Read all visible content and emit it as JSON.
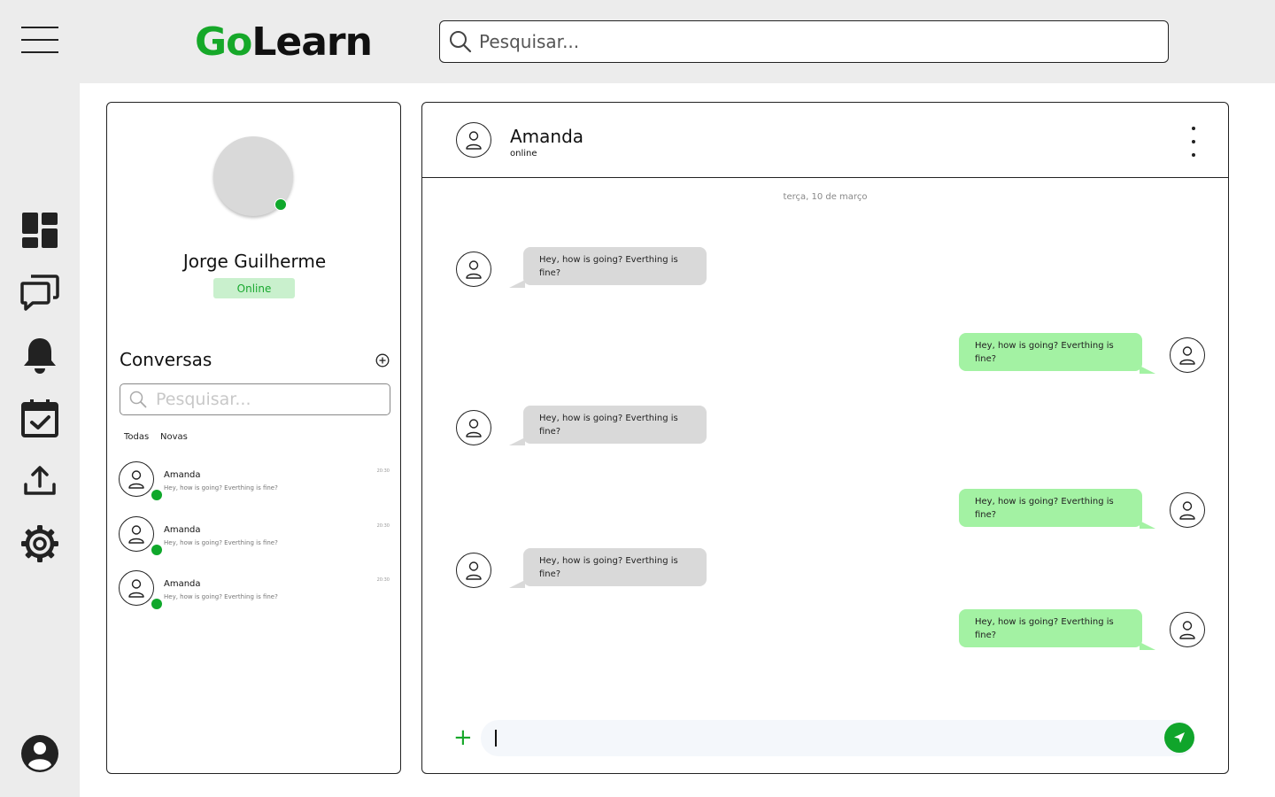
{
  "app": {
    "logo_go": "Go",
    "logo_learn": "Learn"
  },
  "top_search": {
    "placeholder": "Pesquisar..."
  },
  "nav": {
    "icons": [
      "dashboard-icon",
      "chat-bubbles-icon",
      "bell-icon",
      "calendar-check-icon",
      "upload-icon",
      "gear-icon",
      "user-account-icon"
    ]
  },
  "profile": {
    "name": "Jorge Guilherme",
    "status": "Online"
  },
  "conversations": {
    "title": "Conversas",
    "search_placeholder": "Pesquisar...",
    "filters": [
      "Todas",
      "Novas"
    ],
    "items": [
      {
        "name": "Amanda",
        "preview": "Hey, how is going? Everthing is fine?",
        "time": "20:30"
      },
      {
        "name": "Amanda",
        "preview": "Hey, how is going? Everthing is fine?",
        "time": "20:30"
      },
      {
        "name": "Amanda",
        "preview": "Hey, how is going? Everthing is fine?",
        "time": "20:30"
      }
    ]
  },
  "chat": {
    "contact_name": "Amanda",
    "contact_status": "online",
    "date_separator": "terça, 10 de março",
    "messages": [
      {
        "direction": "in",
        "text": "Hey, how is going? Everthing is fine?"
      },
      {
        "direction": "out",
        "text": "Hey, how is going? Everthing is fine?"
      },
      {
        "direction": "in",
        "text": "Hey, how is going? Everthing is fine?"
      },
      {
        "direction": "out",
        "text": "Hey, how is going? Everthing is fine?"
      },
      {
        "direction": "in",
        "text": "Hey, how is going? Everthing is fine?"
      },
      {
        "direction": "out",
        "text": "Hey, how is going? Everthing is fine?"
      }
    ],
    "composer": {
      "value": "",
      "add_label": "+"
    }
  },
  "colors": {
    "brand_green": "#16a829",
    "online_dot": "#0fa82b",
    "bubble_in": "#d9d9d9",
    "bubble_out": "#a3f2a3",
    "status_badge_bg": "#c9f0cd"
  }
}
